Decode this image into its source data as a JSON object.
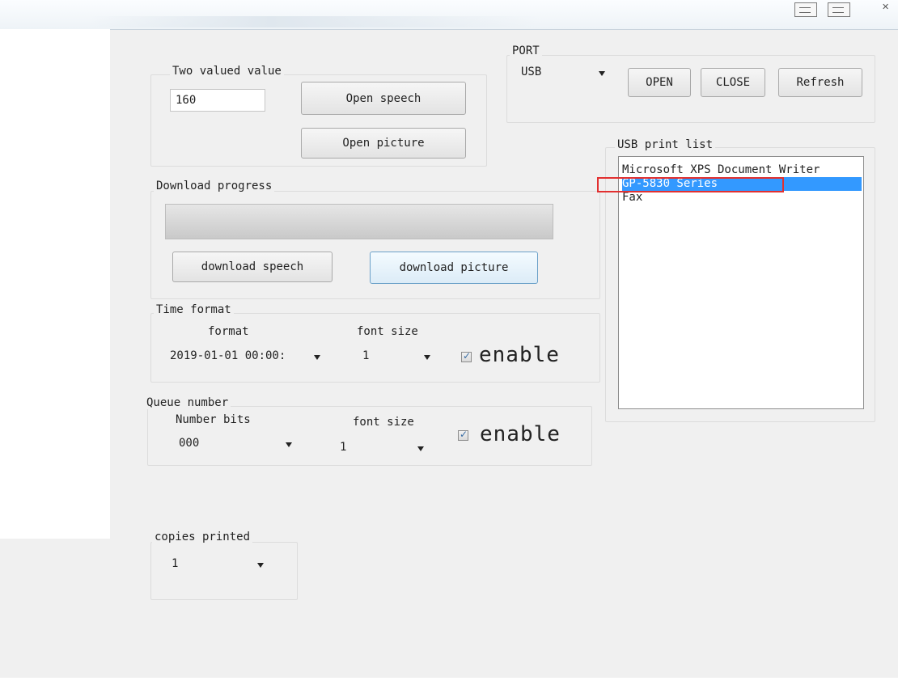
{
  "window": {
    "controls": [
      "minimize-icon",
      "restore-icon",
      "close-icon"
    ]
  },
  "speech_group": {
    "label": "Two valued value",
    "value_input": "160",
    "open_speech_label": "Open speech",
    "open_picture_label": "Open picture"
  },
  "port_group": {
    "label": "PORT",
    "port_value": "USB",
    "open_label": "OPEN",
    "close_label": "CLOSE",
    "refresh_label": "Refresh"
  },
  "download": {
    "label": "Download progress",
    "progress_fraction": 0,
    "download_speech_label": "download speech",
    "download_picture_label": "download picture"
  },
  "usb_list": {
    "label": "USB print list",
    "items": [
      "Microsoft XPS Document Writer",
      "GP-5830 Series",
      "Fax"
    ],
    "selected_index": 1,
    "selected_color": "#3399ff",
    "highlight_box_color": "#e23030"
  },
  "time_format": {
    "label": "Time format",
    "format_label": "format",
    "format_value": "2019-01-01 00:00:",
    "font_size_label": "font size",
    "font_size_value": "1",
    "enable_label": "enable",
    "enabled": true
  },
  "queue_number": {
    "label": "Queue number",
    "bits_label": "Number bits",
    "bits_value": "000",
    "font_size_label": "font size",
    "font_size_value": "1",
    "enable_label": "enable",
    "enabled": true
  },
  "copies": {
    "label": "copies printed",
    "value": "1"
  }
}
